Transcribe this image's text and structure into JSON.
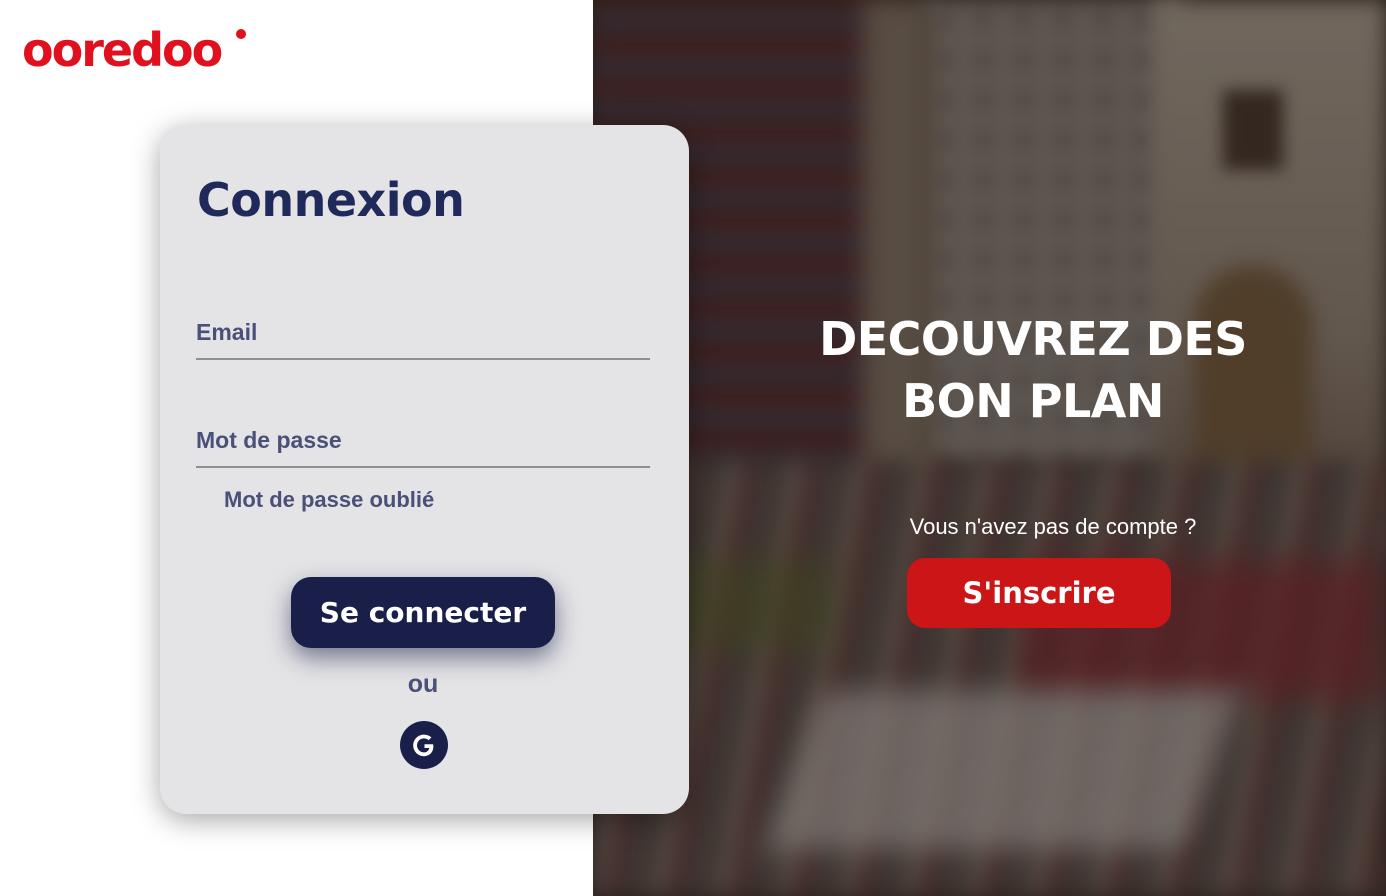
{
  "brand": {
    "name": "ooredoo",
    "color": "#e0101e"
  },
  "login": {
    "title": "Connexion",
    "email_placeholder": "Email",
    "password_placeholder": "Mot de passe",
    "forgot_password": "Mot de passe oublié",
    "submit_label": "Se connecter",
    "or_label": "ou",
    "google_icon": "google-icon",
    "primary_color": "#1a1f4a"
  },
  "hero": {
    "headline_line1": "DECOUVREZ DES",
    "headline_line2": "BON PLAN",
    "no_account_text": "Vous n'avez pas de compte ?",
    "signup_label": "S'inscrire",
    "signup_color": "#cc1517"
  }
}
